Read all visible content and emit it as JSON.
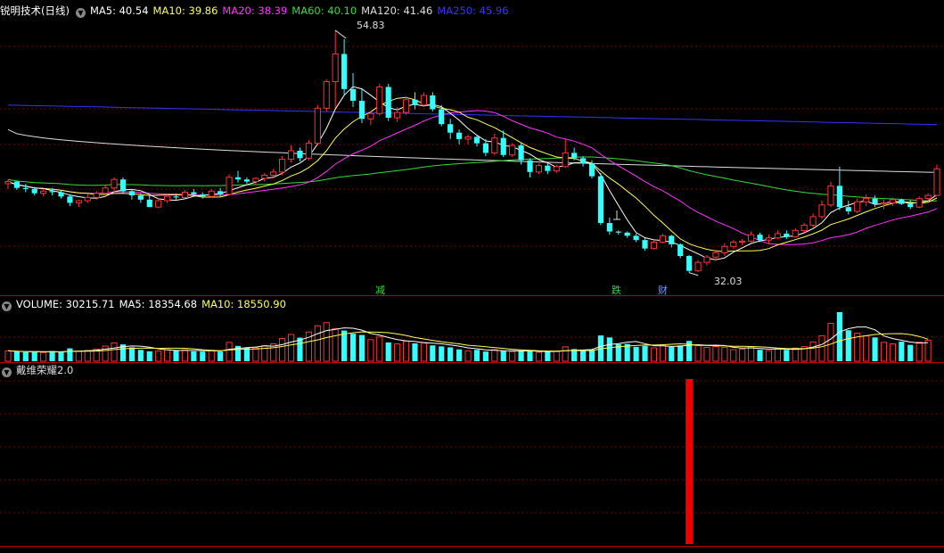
{
  "main": {
    "title": "锐明技术(日线)",
    "ma": [
      {
        "label": "MA5: 40.54",
        "color": "#ffffff"
      },
      {
        "label": "MA10: 39.86",
        "color": "#ffff55"
      },
      {
        "label": "MA20: 38.39",
        "color": "#ff33ff"
      },
      {
        "label": "MA60: 40.10",
        "color": "#33dd33"
      },
      {
        "label": "MA120: 41.46",
        "color": "#dddddd"
      },
      {
        "label": "MA250: 45.96",
        "color": "#3333ff"
      }
    ],
    "high_label": "54.83",
    "low_label": "32.03",
    "events": [
      {
        "text": "减",
        "color": "#33dd33"
      },
      {
        "text": "跌",
        "color": "#33dd33"
      },
      {
        "text": "财",
        "color": "#7799ff"
      }
    ]
  },
  "volume": {
    "legend": [
      {
        "label": "VOLUME: 30215.71",
        "color": "#ffffff"
      },
      {
        "label": "MA5: 18354.68",
        "color": "#ffffff"
      },
      {
        "label": "MA10: 18550.90",
        "color": "#ffff55"
      }
    ]
  },
  "indicator": {
    "title": "戴维荣耀2.0"
  },
  "chart_data": {
    "type": "candlestick",
    "y_range": [
      31,
      56
    ],
    "colors": {
      "up": "#ff3333",
      "down": "#33ffff",
      "ma5": "#ffffff",
      "ma10": "#ffff55",
      "ma20": "#ff33ff",
      "ma60": "#33dd33",
      "ma120": "#dddddd",
      "ma250": "#3333ff"
    },
    "candles": [
      [
        40.4,
        40.8,
        39.9,
        40.6
      ],
      [
        40.6,
        40.7,
        39.8,
        40.0
      ],
      [
        40.0,
        40.4,
        39.6,
        39.9
      ],
      [
        39.9,
        40.1,
        39.3,
        39.5
      ],
      [
        39.5,
        39.9,
        39.2,
        39.7
      ],
      [
        39.7,
        40.0,
        39.3,
        39.6
      ],
      [
        39.6,
        39.8,
        39.0,
        39.2
      ],
      [
        39.2,
        39.4,
        38.3,
        38.6
      ],
      [
        38.6,
        38.9,
        38.2,
        38.8
      ],
      [
        38.8,
        39.4,
        38.6,
        39.1
      ],
      [
        39.1,
        39.7,
        38.9,
        39.5
      ],
      [
        39.5,
        40.3,
        39.2,
        40.0
      ],
      [
        40.0,
        41.0,
        39.6,
        40.8
      ],
      [
        40.8,
        41.0,
        39.5,
        39.7
      ],
      [
        39.7,
        39.9,
        38.9,
        39.3
      ],
      [
        39.3,
        39.5,
        38.6,
        38.9
      ],
      [
        38.9,
        39.3,
        38.4,
        38.2
      ],
      [
        38.2,
        39.0,
        38.1,
        38.8
      ],
      [
        38.8,
        39.4,
        38.6,
        39.2
      ],
      [
        39.2,
        39.5,
        38.9,
        39.1
      ],
      [
        39.1,
        39.8,
        39.0,
        39.6
      ],
      [
        39.6,
        39.9,
        39.3,
        39.4
      ],
      [
        39.4,
        39.6,
        39.0,
        39.2
      ],
      [
        39.2,
        39.9,
        39.1,
        39.7
      ],
      [
        39.7,
        40.0,
        39.2,
        39.4
      ],
      [
        39.4,
        41.3,
        39.3,
        41.0
      ],
      [
        41.0,
        41.6,
        40.5,
        40.8
      ],
      [
        40.8,
        41.0,
        40.4,
        40.6
      ],
      [
        40.6,
        41.0,
        40.3,
        40.9
      ],
      [
        40.9,
        41.4,
        40.6,
        41.2
      ],
      [
        41.2,
        41.8,
        40.9,
        41.5
      ],
      [
        41.5,
        43.0,
        41.2,
        42.7
      ],
      [
        42.7,
        44.0,
        42.4,
        43.5
      ],
      [
        43.5,
        43.8,
        42.5,
        42.8
      ],
      [
        42.8,
        44.5,
        42.6,
        44.2
      ],
      [
        44.2,
        47.8,
        44.0,
        47.5
      ],
      [
        47.5,
        50.2,
        47.2,
        50.0
      ],
      [
        50.0,
        54.83,
        47.5,
        52.6
      ],
      [
        52.6,
        54.0,
        48.8,
        49.3
      ],
      [
        49.3,
        50.8,
        47.6,
        48.2
      ],
      [
        48.2,
        49.3,
        46.1,
        46.5
      ],
      [
        46.5,
        47.2,
        45.9,
        47.0
      ],
      [
        47.0,
        49.8,
        46.8,
        49.5
      ],
      [
        49.5,
        49.8,
        46.3,
        46.6
      ],
      [
        46.6,
        47.6,
        46.2,
        47.1
      ],
      [
        47.1,
        48.6,
        46.9,
        48.3
      ],
      [
        48.3,
        49.0,
        47.4,
        47.8
      ],
      [
        47.8,
        49.0,
        47.6,
        48.7
      ],
      [
        48.7,
        49.0,
        47.2,
        47.4
      ],
      [
        47.4,
        47.8,
        45.8,
        46.0
      ],
      [
        46.0,
        46.5,
        44.6,
        45.2
      ],
      [
        45.2,
        45.5,
        44.1,
        44.6
      ],
      [
        44.6,
        45.0,
        44.1,
        44.8
      ],
      [
        44.8,
        44.9,
        43.9,
        44.2
      ],
      [
        44.2,
        44.6,
        43.0,
        43.3
      ],
      [
        43.3,
        45.1,
        43.1,
        44.7
      ],
      [
        44.7,
        45.4,
        42.9,
        43.1
      ],
      [
        43.1,
        44.2,
        42.9,
        44.0
      ],
      [
        44.0,
        44.2,
        42.2,
        42.6
      ],
      [
        42.6,
        42.8,
        41.0,
        41.5
      ],
      [
        41.5,
        42.3,
        41.3,
        42.1
      ],
      [
        42.1,
        42.3,
        41.3,
        41.6
      ],
      [
        41.6,
        42.2,
        41.4,
        42.0
      ],
      [
        42.0,
        44.6,
        41.9,
        43.3
      ],
      [
        43.3,
        43.8,
        42.6,
        42.8
      ],
      [
        42.8,
        43.0,
        42.0,
        42.3
      ],
      [
        42.3,
        42.6,
        40.9,
        41.1
      ],
      [
        41.1,
        41.4,
        36.5,
        36.7
      ],
      [
        36.7,
        37.2,
        35.6,
        35.9
      ],
      [
        35.9,
        36.0,
        35.6,
        35.8
      ],
      [
        35.8,
        35.9,
        35.3,
        35.5
      ],
      [
        35.5,
        35.7,
        34.9,
        35.1
      ],
      [
        35.1,
        35.3,
        34.1,
        34.3
      ],
      [
        34.3,
        35.1,
        34.2,
        34.9
      ],
      [
        34.9,
        35.7,
        34.8,
        35.5
      ],
      [
        35.5,
        35.6,
        34.4,
        34.7
      ],
      [
        34.7,
        34.8,
        33.4,
        33.6
      ],
      [
        33.6,
        33.7,
        32.03,
        32.2
      ],
      [
        32.2,
        33.2,
        32.1,
        33.0
      ],
      [
        33.0,
        33.7,
        32.7,
        33.5
      ],
      [
        33.5,
        34.2,
        33.2,
        33.9
      ],
      [
        33.9,
        34.8,
        33.6,
        34.5
      ],
      [
        34.5,
        35.1,
        34.3,
        34.9
      ],
      [
        34.9,
        35.2,
        34.6,
        35.0
      ],
      [
        35.0,
        35.9,
        34.9,
        35.6
      ],
      [
        35.6,
        35.8,
        34.9,
        35.1
      ],
      [
        35.1,
        35.6,
        34.7,
        35.3
      ],
      [
        35.3,
        36.0,
        35.2,
        35.7
      ],
      [
        35.7,
        36.0,
        35.2,
        35.4
      ],
      [
        35.4,
        36.2,
        35.3,
        36.0
      ],
      [
        36.0,
        36.7,
        35.8,
        36.5
      ],
      [
        36.5,
        37.6,
        36.3,
        37.3
      ],
      [
        37.3,
        38.8,
        37.1,
        38.4
      ],
      [
        38.4,
        40.6,
        38.2,
        40.2
      ],
      [
        40.2,
        42.0,
        37.9,
        38.2
      ],
      [
        38.2,
        38.8,
        37.5,
        37.8
      ],
      [
        37.8,
        39.0,
        37.6,
        38.7
      ],
      [
        38.7,
        39.4,
        38.3,
        39.0
      ],
      [
        39.0,
        39.3,
        38.2,
        38.5
      ],
      [
        38.5,
        38.9,
        38.0,
        38.6
      ],
      [
        38.6,
        39.1,
        38.3,
        38.9
      ],
      [
        38.9,
        39.0,
        38.4,
        38.5
      ],
      [
        38.5,
        38.9,
        38.0,
        38.2
      ],
      [
        38.2,
        39.2,
        38.1,
        39.0
      ],
      [
        39.0,
        39.5,
        38.7,
        39.3
      ],
      [
        39.3,
        42.2,
        39.2,
        41.8
      ]
    ],
    "volumes": [
      4200,
      3800,
      3600,
      3900,
      3500,
      4100,
      3700,
      5200,
      4000,
      4300,
      4900,
      6100,
      7400,
      6800,
      5600,
      4600,
      4000,
      4100,
      4700,
      4300,
      4600,
      4000,
      3900,
      4400,
      3900,
      7600,
      6200,
      5500,
      5400,
      6300,
      7000,
      9200,
      10800,
      9500,
      11800,
      14300,
      15600,
      13200,
      12400,
      11100,
      10600,
      8700,
      9800,
      7600,
      7000,
      8100,
      7200,
      7600,
      6400,
      6000,
      5600,
      4800,
      4200,
      4600,
      3900,
      4700,
      4100,
      3900,
      4300,
      4100,
      3600,
      3800,
      4000,
      5800,
      4900,
      4200,
      4600,
      10400,
      9600,
      6900,
      7000,
      5800,
      6200,
      5400,
      6600,
      5800,
      6400,
      8200,
      6300,
      5600,
      5900,
      5600,
      4700,
      4900,
      5900,
      4600,
      4300,
      5000,
      4600,
      5300,
      5900,
      7800,
      10300,
      15300,
      19800,
      12500,
      11300,
      10200,
      9600,
      7600,
      7000,
      7900,
      6600,
      7700,
      8500
    ]
  }
}
